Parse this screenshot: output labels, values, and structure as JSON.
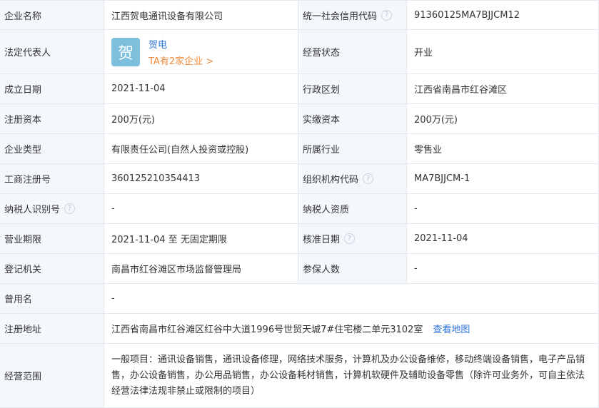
{
  "rows": {
    "r1": {
      "l1": "企业名称",
      "v1": "江西贺电通讯设备有限公司",
      "l2": "统一社会信用代码",
      "v2": "91360125MA7BJJCM12"
    },
    "r2": {
      "l1": "法定代表人",
      "avatar_char": "贺",
      "rep_name": "贺电",
      "rep_link": "TA有2家企业 >",
      "l2": "经营状态",
      "v2": "开业"
    },
    "r3": {
      "l1": "成立日期",
      "v1": "2021-11-04",
      "l2": "行政区划",
      "v2": "江西省南昌市红谷滩区"
    },
    "r4": {
      "l1": "注册资本",
      "v1": "200万(元)",
      "l2": "实缴资本",
      "v2": "200万(元)"
    },
    "r5": {
      "l1": "企业类型",
      "v1": "有限责任公司(自然人投资或控股)",
      "l2": "所属行业",
      "v2": "零售业"
    },
    "r6": {
      "l1": "工商注册号",
      "v1": "360125210354413",
      "l2": "组织机构代码",
      "v2": "MA7BJJCM-1"
    },
    "r7": {
      "l1": "纳税人识别号",
      "v1": "-",
      "l2": "纳税人资质",
      "v2": "-"
    },
    "r8": {
      "l1": "营业期限",
      "v1": "2021-11-04 至 无固定期限",
      "l2": "核准日期",
      "v2": "2021-11-04"
    },
    "r9": {
      "l1": "登记机关",
      "v1": "南昌市红谷滩区市场监督管理局",
      "l2": "参保人数",
      "v2": "-"
    },
    "r10": {
      "l1": "曾用名",
      "v1": "-"
    },
    "r11": {
      "l1": "注册地址",
      "v1": "江西省南昌市红谷滩区红谷中大道1996号世贸天城7#住宅楼二单元3102室",
      "map_link": "查看地图"
    },
    "r12": {
      "l1": "经营范围",
      "v1": "一般项目：通讯设备销售，通讯设备修理，网络技术服务，计算机及办公设备维修，移动终端设备销售，电子产品销售，办公设备销售，办公用品销售，办公设备耗材销售，计算机软硬件及辅助设备零售（除许可业务外，可自主依法经营法律法规非禁止或限制的项目）"
    }
  },
  "help_icon_glyph": "?",
  "colors": {
    "label_bg": "#f4f7fc",
    "border": "#e4e9f0",
    "link": "#2e73d8",
    "orange": "#f08a3c",
    "avatar_bg": "#7fbfde"
  }
}
